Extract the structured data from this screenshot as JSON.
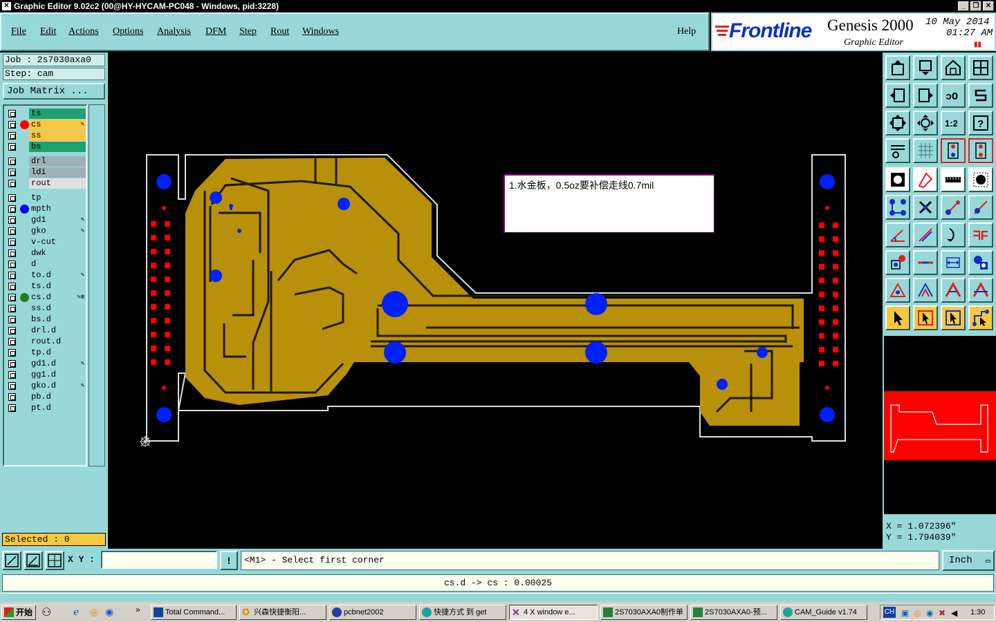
{
  "window": {
    "title": "Graphic Editor 9.02c2 (00@HY-HYCAM-PC048 - Windows, pid:3228)",
    "icon": "x-icon",
    "controls": [
      "minimize-icon",
      "restore-icon",
      "close-icon"
    ]
  },
  "menu": {
    "items": [
      "File",
      "Edit",
      "Actions",
      "Options",
      "Analysis",
      "DFM",
      "Step",
      "Rout",
      "Windows"
    ],
    "help": "Help"
  },
  "brand": {
    "logo": "Frontline",
    "product": "Genesis 2000",
    "subtitle": "Graphic Editor",
    "date": "10 May 2014",
    "time": "01:27 AM"
  },
  "job": {
    "job_label": "Job : 2s7030axa0",
    "step_label": "Step: cam",
    "matrix_button": "Job Matrix ..."
  },
  "layers": [
    {
      "name": "ts",
      "bg": "#20a070",
      "dot": ""
    },
    {
      "name": "cs",
      "bg": "#f8c840",
      "dot": "#ff0000",
      "mark": "edit"
    },
    {
      "name": "ss",
      "bg": "#f8c840",
      "dot": ""
    },
    {
      "name": "bs",
      "bg": "#20a070",
      "dot": ""
    },
    {
      "name": "drl",
      "bg": "#a0b0b8",
      "dot": ""
    },
    {
      "name": "ldi",
      "bg": "#a0b0b8",
      "dot": ""
    },
    {
      "name": "rout",
      "bg": "#e0e0e0",
      "dot": ""
    },
    {
      "name": "tp",
      "bg": "#98d8d8",
      "dot": ""
    },
    {
      "name": "mpth",
      "bg": "#98d8d8",
      "dot": "#0000ff"
    },
    {
      "name": "gd1",
      "bg": "#98d8d8",
      "dot": "",
      "mark": "edit"
    },
    {
      "name": "gko",
      "bg": "#98d8d8",
      "dot": "",
      "mark": "edit"
    },
    {
      "name": "v-cut",
      "bg": "#98d8d8",
      "dot": ""
    },
    {
      "name": "dwk",
      "bg": "#98d8d8",
      "dot": ""
    },
    {
      "name": "d",
      "bg": "#98d8d8",
      "dot": ""
    },
    {
      "name": "to.d",
      "bg": "#98d8d8",
      "dot": "",
      "mark": "edit"
    },
    {
      "name": "ts.d",
      "bg": "#98d8d8",
      "dot": ""
    },
    {
      "name": "cs.d",
      "bg": "#98d8d8",
      "dot": "#208020",
      "mark": "work"
    },
    {
      "name": "ss.d",
      "bg": "#98d8d8",
      "dot": ""
    },
    {
      "name": "bs.d",
      "bg": "#98d8d8",
      "dot": ""
    },
    {
      "name": "drl.d",
      "bg": "#98d8d8",
      "dot": ""
    },
    {
      "name": "rout.d",
      "bg": "#98d8d8",
      "dot": ""
    },
    {
      "name": "tp.d",
      "bg": "#98d8d8",
      "dot": ""
    },
    {
      "name": "gd1.d",
      "bg": "#98d8d8",
      "dot": "",
      "mark": "edit"
    },
    {
      "name": "gg1.d",
      "bg": "#98d8d8",
      "dot": ""
    },
    {
      "name": "gko.d",
      "bg": "#98d8d8",
      "dot": "",
      "mark": "edit"
    },
    {
      "name": "pb.d",
      "bg": "#98d8d8",
      "dot": ""
    },
    {
      "name": "pt.d",
      "bg": "#98d8d8",
      "dot": ""
    }
  ],
  "selected": "Selected : 0",
  "note": "1.水金板，0.5oz要补偿走线0.7mil",
  "coords": {
    "x": "X = 1.072396\"",
    "y": "Y = 1.794039\""
  },
  "command": {
    "xy_label": "X Y :",
    "xy_value": "",
    "prompt": "<M1> - Select first corner",
    "unit": "Inch"
  },
  "status": "cs.d -> cs : 0.00025",
  "taskbar": {
    "start": "开始",
    "tasks": [
      "Total Command...",
      "兴森快捷衡阳...",
      "pcbnet2002",
      "快捷方式 到 get",
      "4 X window e...",
      "2S7030AXA0制作单",
      "2S7030AXA0-预...",
      "CAM_Guide v1.74"
    ],
    "lang": "CH",
    "clock": "1:30"
  },
  "colors": {
    "panel": "#98d8d8",
    "copper": "#b8900a",
    "pad": "#0020ff",
    "smd": "#ff0000"
  }
}
